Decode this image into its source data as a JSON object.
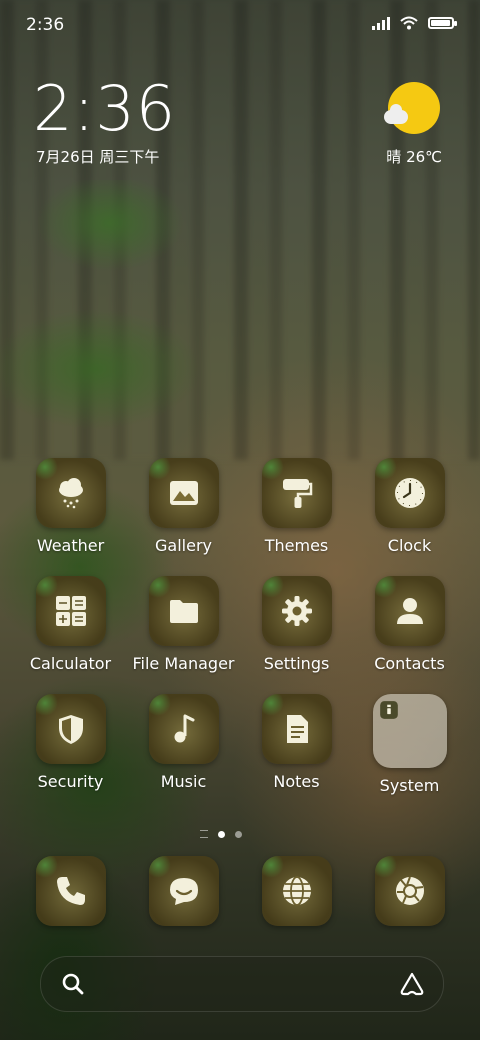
{
  "status_bar": {
    "time": "2:36"
  },
  "clock_widget": {
    "time": "2:36",
    "date": "7月26日 周三下午"
  },
  "weather_widget": {
    "condition_temp": "晴 26℃",
    "icon": "sunny-cloud-icon"
  },
  "apps": [
    [
      {
        "label": "Weather",
        "icon": "weather-icon"
      },
      {
        "label": "Gallery",
        "icon": "gallery-icon"
      },
      {
        "label": "Themes",
        "icon": "themes-icon"
      },
      {
        "label": "Clock",
        "icon": "clock-icon"
      }
    ],
    [
      {
        "label": "Calculator",
        "icon": "calculator-icon"
      },
      {
        "label": "File Manager",
        "icon": "folder-icon"
      },
      {
        "label": "Settings",
        "icon": "gear-icon"
      },
      {
        "label": "Contacts",
        "icon": "contacts-icon"
      }
    ],
    [
      {
        "label": "Security",
        "icon": "shield-icon"
      },
      {
        "label": "Music",
        "icon": "music-icon"
      },
      {
        "label": "Notes",
        "icon": "notes-icon"
      },
      {
        "label": "System",
        "icon": "folder-system-icon"
      }
    ]
  ],
  "page_indicator": {
    "pages": 2,
    "active": 0
  },
  "dock": [
    {
      "icon": "phone-icon"
    },
    {
      "icon": "messages-icon"
    },
    {
      "icon": "browser-icon"
    },
    {
      "icon": "camera-icon"
    }
  ],
  "search_bar": {
    "left_icon": "search-icon",
    "right_icon": "assistant-icon"
  },
  "colors": {
    "tile": "#6e6436",
    "sun": "#f5c912",
    "text": "#ffffff"
  }
}
